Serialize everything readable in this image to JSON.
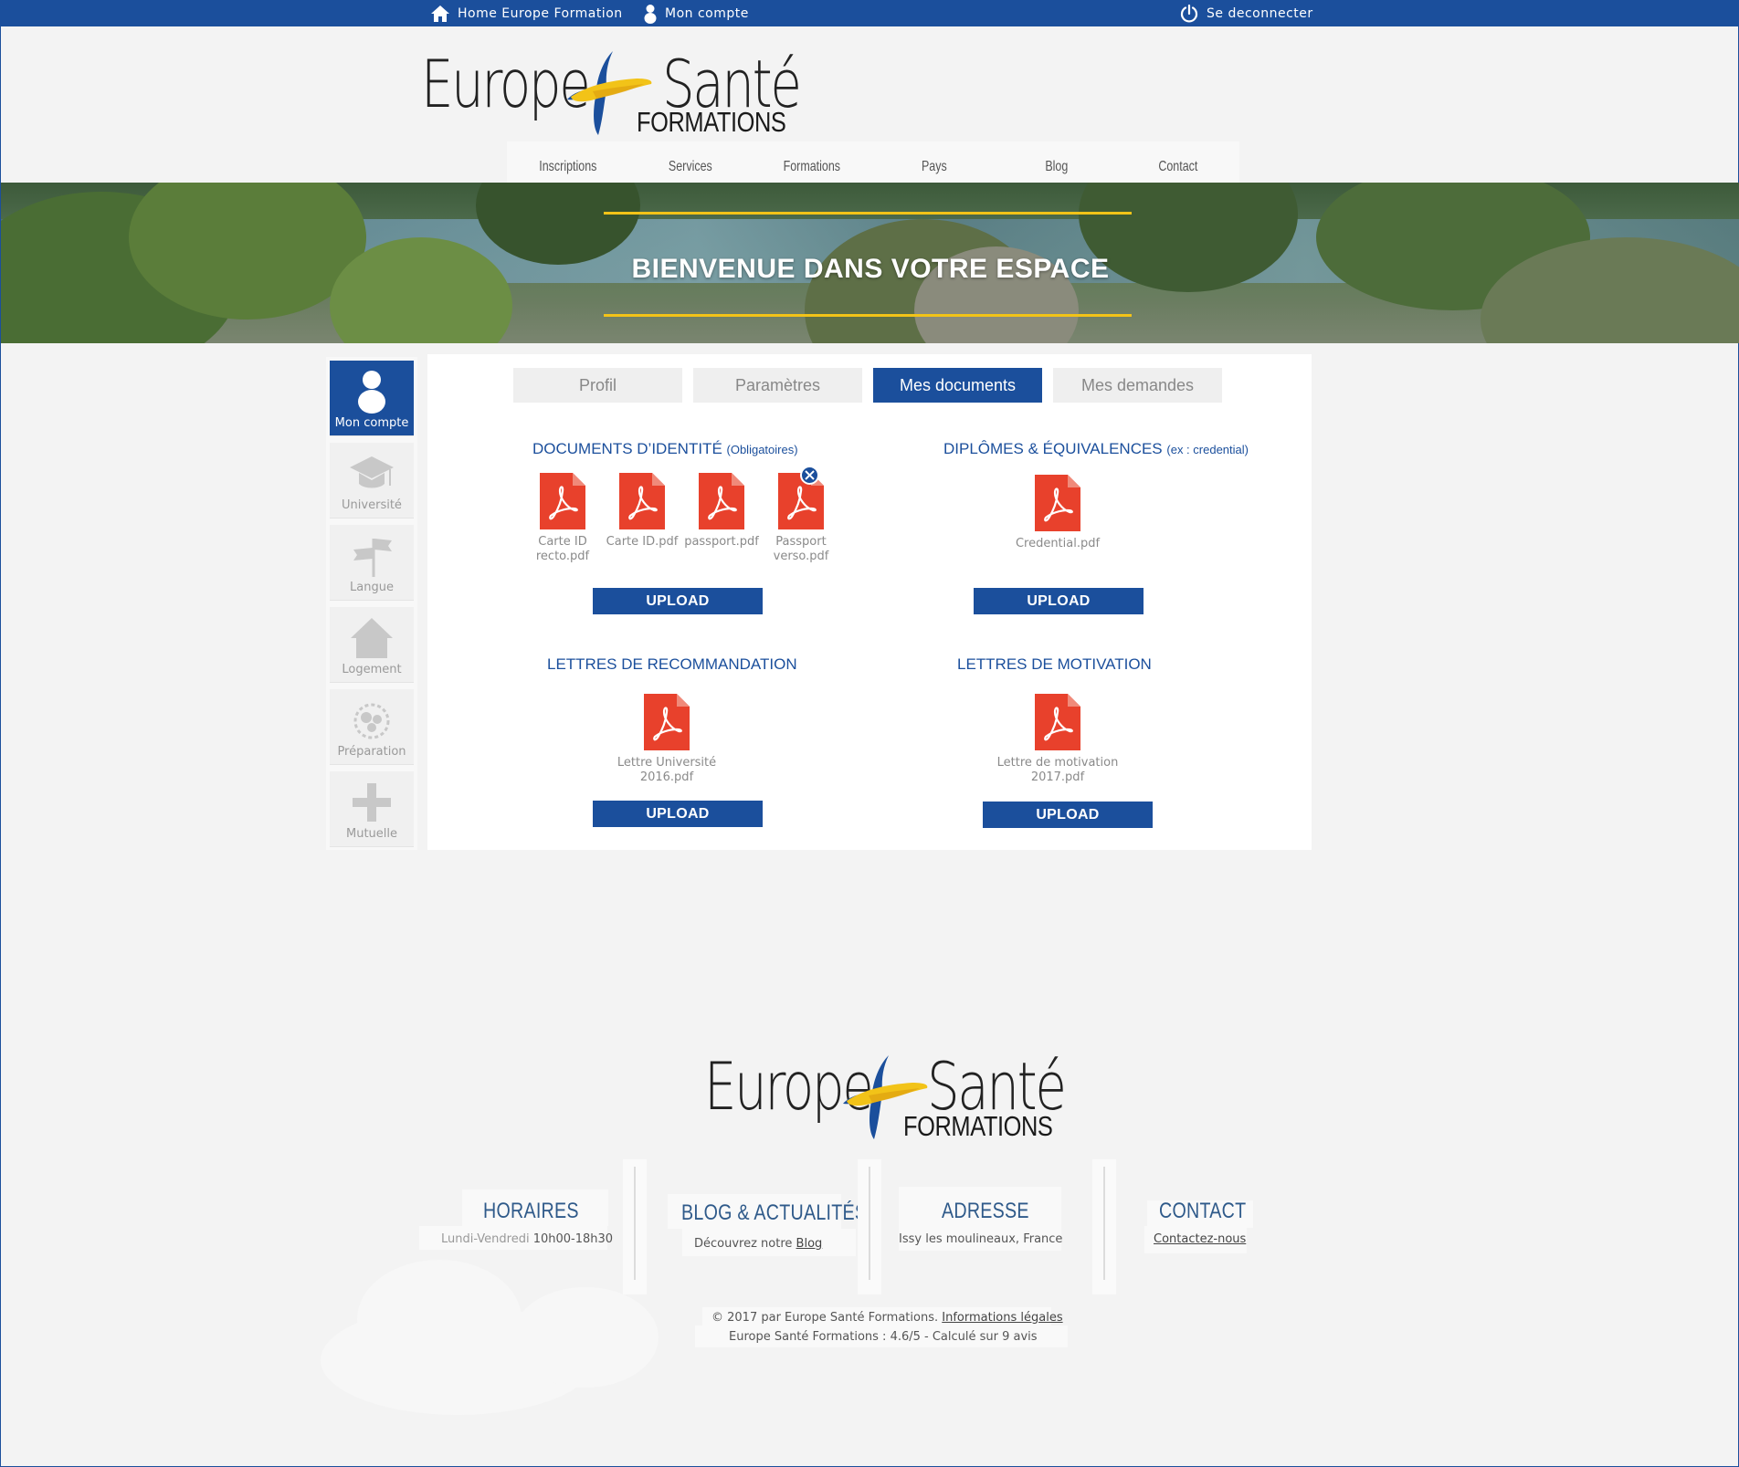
{
  "topbar": {
    "home_label": "Home Europe Formation",
    "account_label": "Mon compte",
    "logout_label": "Se deconnecter"
  },
  "logo": {
    "word_left": "Europe",
    "word_right": "Santé",
    "word_bottom": "FORMATIONS"
  },
  "nav": {
    "items": [
      "Inscriptions",
      "Services",
      "Formations",
      "Pays",
      "Blog",
      "Contact"
    ]
  },
  "hero": {
    "title": "BIENVENUE DANS VOTRE ESPACE"
  },
  "sidebar": {
    "items": [
      {
        "label": "Mon compte",
        "icon": "user-icon",
        "active": true
      },
      {
        "label": "Université",
        "icon": "graduation-cap-icon",
        "active": false
      },
      {
        "label": "Langue",
        "icon": "flags-icon",
        "active": false
      },
      {
        "label": "Logement",
        "icon": "house-icon",
        "active": false
      },
      {
        "label": "Préparation",
        "icon": "gears-icon",
        "active": false
      },
      {
        "label": "Mutuelle",
        "icon": "plus-icon",
        "active": false
      }
    ]
  },
  "tabs": [
    {
      "label": "Profil",
      "active": false
    },
    {
      "label": "Paramètres",
      "active": false
    },
    {
      "label": "Mes documents",
      "active": true
    },
    {
      "label": "Mes demandes",
      "active": false
    }
  ],
  "sections": {
    "identity": {
      "title": "DOCUMENTS D’IDENTITÉ",
      "note": "(Obligatoires)",
      "files": [
        "Carte ID recto.pdf",
        "Carte ID.pdf",
        "passport.pdf",
        "Passport verso.pdf"
      ],
      "upload_label": "UPLOAD"
    },
    "diplomas": {
      "title": "DIPLÔMES & ÉQUIVALENCES",
      "note": "(ex : credential)",
      "files": [
        "Credential.pdf"
      ],
      "upload_label": "UPLOAD"
    },
    "recommendation": {
      "title": "LETTRES DE RECOMMANDATION",
      "files": [
        "Lettre Université 2016.pdf"
      ],
      "upload_label": "UPLOAD"
    },
    "motivation": {
      "title": "LETTRES DE MOTIVATION",
      "files": [
        "Lettre de motivation 2017.pdf"
      ],
      "upload_label": "UPLOAD"
    }
  },
  "colors": {
    "brand_blue": "#1b4f9c",
    "accent_yellow": "#f2c318",
    "pdf_red": "#e8412c"
  },
  "footer": {
    "hours": {
      "heading": "HORAIRES",
      "days": "Lundi-Vendredi",
      "time": "10h00-18h30"
    },
    "blog": {
      "heading": "BLOG & ACTUALITÉS",
      "text": "Découvrez notre",
      "link": "Blog"
    },
    "address": {
      "heading": "ADRESSE",
      "text": "Issy les moulineaux, France"
    },
    "contact": {
      "heading": "CONTACT",
      "link": "Contactez-nous"
    },
    "copyright_text": "© 2017 par Europe Santé Formations.",
    "legal_link": "Informations légales",
    "rating": "Europe Santé Formations : 4.6/5 - Calculé sur 9 avis"
  }
}
